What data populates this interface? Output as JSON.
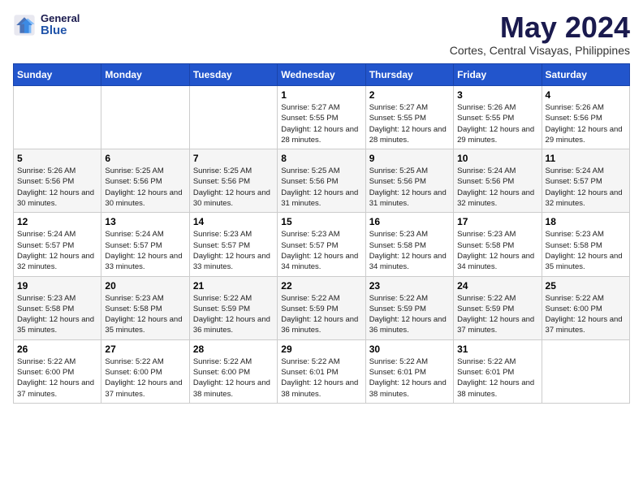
{
  "header": {
    "logo_general": "General",
    "logo_blue": "Blue",
    "month_title": "May 2024",
    "location": "Cortes, Central Visayas, Philippines"
  },
  "weekdays": [
    "Sunday",
    "Monday",
    "Tuesday",
    "Wednesday",
    "Thursday",
    "Friday",
    "Saturday"
  ],
  "weeks": [
    [
      {
        "day": "",
        "info": ""
      },
      {
        "day": "",
        "info": ""
      },
      {
        "day": "",
        "info": ""
      },
      {
        "day": "1",
        "info": "Sunrise: 5:27 AM\nSunset: 5:55 PM\nDaylight: 12 hours and 28 minutes."
      },
      {
        "day": "2",
        "info": "Sunrise: 5:27 AM\nSunset: 5:55 PM\nDaylight: 12 hours and 28 minutes."
      },
      {
        "day": "3",
        "info": "Sunrise: 5:26 AM\nSunset: 5:55 PM\nDaylight: 12 hours and 29 minutes."
      },
      {
        "day": "4",
        "info": "Sunrise: 5:26 AM\nSunset: 5:56 PM\nDaylight: 12 hours and 29 minutes."
      }
    ],
    [
      {
        "day": "5",
        "info": "Sunrise: 5:26 AM\nSunset: 5:56 PM\nDaylight: 12 hours and 30 minutes."
      },
      {
        "day": "6",
        "info": "Sunrise: 5:25 AM\nSunset: 5:56 PM\nDaylight: 12 hours and 30 minutes."
      },
      {
        "day": "7",
        "info": "Sunrise: 5:25 AM\nSunset: 5:56 PM\nDaylight: 12 hours and 30 minutes."
      },
      {
        "day": "8",
        "info": "Sunrise: 5:25 AM\nSunset: 5:56 PM\nDaylight: 12 hours and 31 minutes."
      },
      {
        "day": "9",
        "info": "Sunrise: 5:25 AM\nSunset: 5:56 PM\nDaylight: 12 hours and 31 minutes."
      },
      {
        "day": "10",
        "info": "Sunrise: 5:24 AM\nSunset: 5:56 PM\nDaylight: 12 hours and 32 minutes."
      },
      {
        "day": "11",
        "info": "Sunrise: 5:24 AM\nSunset: 5:57 PM\nDaylight: 12 hours and 32 minutes."
      }
    ],
    [
      {
        "day": "12",
        "info": "Sunrise: 5:24 AM\nSunset: 5:57 PM\nDaylight: 12 hours and 32 minutes."
      },
      {
        "day": "13",
        "info": "Sunrise: 5:24 AM\nSunset: 5:57 PM\nDaylight: 12 hours and 33 minutes."
      },
      {
        "day": "14",
        "info": "Sunrise: 5:23 AM\nSunset: 5:57 PM\nDaylight: 12 hours and 33 minutes."
      },
      {
        "day": "15",
        "info": "Sunrise: 5:23 AM\nSunset: 5:57 PM\nDaylight: 12 hours and 34 minutes."
      },
      {
        "day": "16",
        "info": "Sunrise: 5:23 AM\nSunset: 5:58 PM\nDaylight: 12 hours and 34 minutes."
      },
      {
        "day": "17",
        "info": "Sunrise: 5:23 AM\nSunset: 5:58 PM\nDaylight: 12 hours and 34 minutes."
      },
      {
        "day": "18",
        "info": "Sunrise: 5:23 AM\nSunset: 5:58 PM\nDaylight: 12 hours and 35 minutes."
      }
    ],
    [
      {
        "day": "19",
        "info": "Sunrise: 5:23 AM\nSunset: 5:58 PM\nDaylight: 12 hours and 35 minutes."
      },
      {
        "day": "20",
        "info": "Sunrise: 5:23 AM\nSunset: 5:58 PM\nDaylight: 12 hours and 35 minutes."
      },
      {
        "day": "21",
        "info": "Sunrise: 5:22 AM\nSunset: 5:59 PM\nDaylight: 12 hours and 36 minutes."
      },
      {
        "day": "22",
        "info": "Sunrise: 5:22 AM\nSunset: 5:59 PM\nDaylight: 12 hours and 36 minutes."
      },
      {
        "day": "23",
        "info": "Sunrise: 5:22 AM\nSunset: 5:59 PM\nDaylight: 12 hours and 36 minutes."
      },
      {
        "day": "24",
        "info": "Sunrise: 5:22 AM\nSunset: 5:59 PM\nDaylight: 12 hours and 37 minutes."
      },
      {
        "day": "25",
        "info": "Sunrise: 5:22 AM\nSunset: 6:00 PM\nDaylight: 12 hours and 37 minutes."
      }
    ],
    [
      {
        "day": "26",
        "info": "Sunrise: 5:22 AM\nSunset: 6:00 PM\nDaylight: 12 hours and 37 minutes."
      },
      {
        "day": "27",
        "info": "Sunrise: 5:22 AM\nSunset: 6:00 PM\nDaylight: 12 hours and 37 minutes."
      },
      {
        "day": "28",
        "info": "Sunrise: 5:22 AM\nSunset: 6:00 PM\nDaylight: 12 hours and 38 minutes."
      },
      {
        "day": "29",
        "info": "Sunrise: 5:22 AM\nSunset: 6:01 PM\nDaylight: 12 hours and 38 minutes."
      },
      {
        "day": "30",
        "info": "Sunrise: 5:22 AM\nSunset: 6:01 PM\nDaylight: 12 hours and 38 minutes."
      },
      {
        "day": "31",
        "info": "Sunrise: 5:22 AM\nSunset: 6:01 PM\nDaylight: 12 hours and 38 minutes."
      },
      {
        "day": "",
        "info": ""
      }
    ]
  ]
}
